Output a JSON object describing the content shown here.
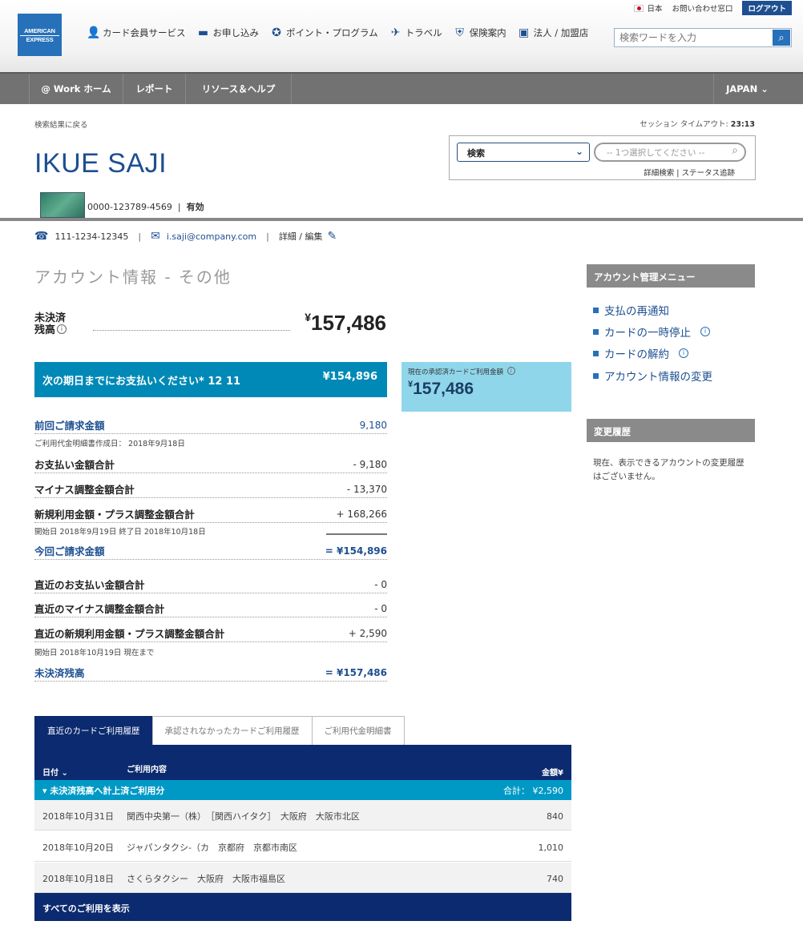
{
  "header": {
    "logo_line1": "AMERICAN",
    "logo_line2": "EXPRESS",
    "utility": {
      "country": "日本",
      "contact": "お問い合わせ窓口",
      "logout": "ログアウト"
    },
    "nav": [
      {
        "label": "カード会員サービス",
        "icon": "person-icon"
      },
      {
        "label": "お申し込み",
        "icon": "card-icon"
      },
      {
        "label": "ポイント・プログラム",
        "icon": "gear-badge-icon"
      },
      {
        "label": "トラベル",
        "icon": "airplane-icon"
      },
      {
        "label": "保険案内",
        "icon": "shield-icon"
      },
      {
        "label": "法人 / 加盟店",
        "icon": "chart-icon"
      }
    ],
    "search_placeholder": "検索ワードを入力"
  },
  "subnav": {
    "work_home": "@ Work ホーム",
    "report": "レポート",
    "resources": "リソース＆ヘルプ",
    "region": "JAPAN"
  },
  "profile": {
    "back_link": "検索結果に戻る",
    "session_label": "セッション タイムアウト:",
    "session_time": "23:13",
    "name": "IKUE SAJI",
    "search_select": "検索",
    "search_pill_placeholder": "-- 1つ選択してください --",
    "advanced_search": "詳細検索",
    "status_tracking": "ステータス追跡",
    "card_number": "0000-123789-4569",
    "card_status": "有効",
    "phone": "111-1234-12345",
    "email": "i.saji@company.com",
    "detail_edit": "詳細 / 編集"
  },
  "account": {
    "section_title": "アカウント情報 - その他",
    "outstanding_label": "未決済残高",
    "outstanding_value": "157,486",
    "due_label": "次の期日までにお支払いください* 12 11",
    "due_value": "¥154,896",
    "current_label": "現在の承認済カードご利用金額",
    "current_value": "157,486",
    "rows": {
      "prev_bill": {
        "label": "前回ご請求金額",
        "value": "9,180",
        "sub": "ご利用代金明細書作成日： 2018年9月18日"
      },
      "payments": {
        "label": "お支払い金額合計",
        "value": "- 9,180"
      },
      "minus_adj": {
        "label": "マイナス調整金額合計",
        "value": "- 13,370"
      },
      "new_charges": {
        "label": "新規利用金額・プラス調整金額合計",
        "value": "+ 168,266",
        "sub": "開始日 2018年9月19日 終了日 2018年10月18日"
      },
      "this_bill": {
        "label": "今回ご請求金額",
        "value": "= ¥154,896"
      },
      "recent_pay": {
        "label": "直近のお支払い金額合計",
        "value": "- 0"
      },
      "recent_minus": {
        "label": "直近のマイナス調整金額合計",
        "value": "- 0"
      },
      "recent_new": {
        "label": "直近の新規利用金額・プラス調整金額合計",
        "value": "+ 2,590",
        "sub": "開始日 2018年10月19日 現在まで"
      },
      "unsettled": {
        "label": "未決済残高",
        "value": "= ¥157,486"
      }
    }
  },
  "side_menu": {
    "title": "アカウント管理メニュー",
    "items": [
      "支払の再通知",
      "カードの一時停止",
      "カードの解約",
      "アカウント情報の変更"
    ],
    "history_title": "変更履歴",
    "history_text": "現在、表示できるアカウントの変更履歴はございません。"
  },
  "transactions": {
    "tabs": [
      "直近のカードご利用履歴",
      "承認されなかったカードご利用履歴",
      "ご利用代金明細書"
    ],
    "col_date": "日付",
    "col_desc": "ご利用内容",
    "col_amount": "金額¥",
    "group_label": "未決済残高へ計上済ご利用分",
    "group_total": "合計： ¥2,590",
    "rows": [
      {
        "date": "2018年10月31日",
        "desc": "関西中央第一（株）　［関西ハイタク］　大阪府　大阪市北区",
        "amount": "840"
      },
      {
        "date": "2018年10月20日",
        "desc": "ジャパンタクシ-（カ　京都府　京都市南区",
        "amount": "1,010"
      },
      {
        "date": "2018年10月18日",
        "desc": "さくらタクシー　大阪府　大阪市福島区",
        "amount": "740"
      }
    ],
    "show_all": "すべてのご利用を表示"
  }
}
